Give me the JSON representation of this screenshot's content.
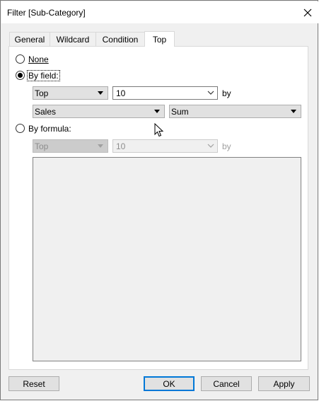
{
  "window": {
    "title": "Filter [Sub-Category]"
  },
  "tabs": [
    {
      "label": "General"
    },
    {
      "label": "Wildcard"
    },
    {
      "label": "Condition"
    },
    {
      "label": "Top",
      "active": true
    }
  ],
  "top_tab": {
    "none_label": "None",
    "by_field": {
      "label": "By field:",
      "selected": true,
      "direction": "Top",
      "count": "10",
      "by_label": "by",
      "field": "Sales",
      "aggregation": "Sum"
    },
    "by_formula": {
      "label": "By formula:",
      "selected": false,
      "direction": "Top",
      "count": "10",
      "by_label": "by",
      "formula_text": ""
    }
  },
  "buttons": {
    "reset": "Reset",
    "ok": "OK",
    "cancel": "Cancel",
    "apply": "Apply"
  }
}
